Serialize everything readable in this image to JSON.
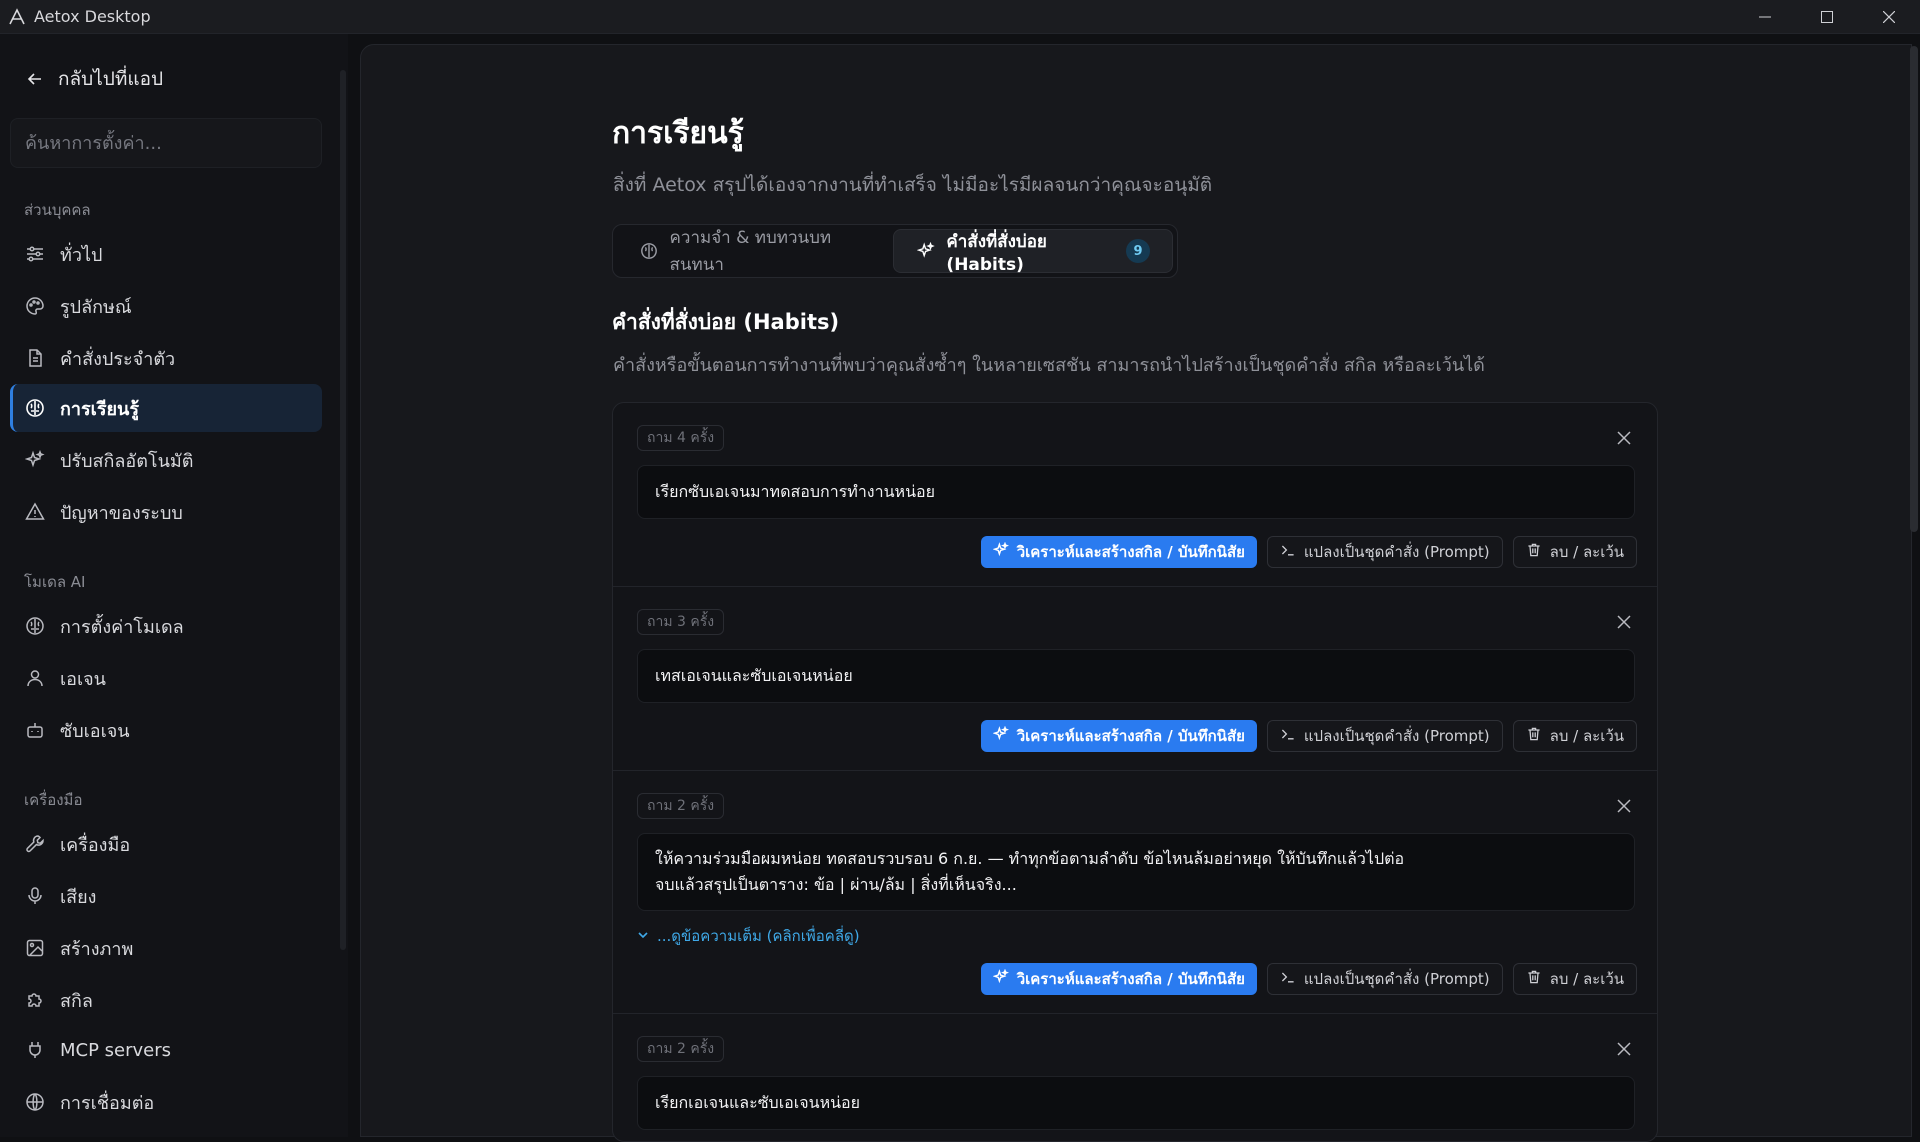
{
  "window": {
    "title": "Aetox Desktop"
  },
  "sidebar": {
    "back_label": "กลับไปที่แอป",
    "search_placeholder": "ค้นหาการตั้งค่า...",
    "sections": [
      {
        "label": "ส่วนบุคคล"
      },
      {
        "label": "โมเดล AI"
      },
      {
        "label": "เครื่องมือ"
      }
    ],
    "items": [
      {
        "label": "ทั่วไป",
        "icon": "sliders-icon"
      },
      {
        "label": "รูปลักษณ์",
        "icon": "palette-icon"
      },
      {
        "label": "คำสั่งประจำตัว",
        "icon": "document-icon"
      },
      {
        "label": "การเรียนรู้",
        "icon": "brain-icon",
        "active": true
      },
      {
        "label": "ปรับสกิลอัตโนมัติ",
        "icon": "sparkles-icon"
      },
      {
        "label": "ปัญหาของระบบ",
        "icon": "warning-icon"
      },
      {
        "label": "การตั้งค่าโมเดล",
        "icon": "brain-icon"
      },
      {
        "label": "เอเจน",
        "icon": "user-icon"
      },
      {
        "label": "ซับเอเจน",
        "icon": "bot-icon"
      },
      {
        "label": "เครื่องมือ",
        "icon": "wrench-icon"
      },
      {
        "label": "เสียง",
        "icon": "microphone-icon"
      },
      {
        "label": "สร้างภาพ",
        "icon": "image-icon"
      },
      {
        "label": "สกิล",
        "icon": "puzzle-icon"
      },
      {
        "label": "MCP servers",
        "icon": "plug-icon"
      },
      {
        "label": "การเชื่อมต่อ",
        "icon": "globe-icon"
      }
    ]
  },
  "page": {
    "title": "การเรียนรู้",
    "subtitle": "สิ่งที่ Aetox สรุปได้เองจากงานที่ทำเสร็จ ไม่มีอะไรมีผลจนกว่าคุณจะอนุมัติ",
    "tabs": [
      {
        "label": "ความจำ & ทบทวนบทสนทนา",
        "icon": "brain-icon"
      },
      {
        "label": "คำสั่งที่สั่งบ่อย (Habits)",
        "icon": "sparkles-icon",
        "count": "9",
        "active": true
      }
    ],
    "section_title": "คำสั่งที่สั่งบ่อย (Habits)",
    "section_desc": "คำสั่งหรือขั้นตอนการทำงานที่พบว่าคุณสั่งซ้ำๆ ในหลายเซสชัน สามารถนำไปสร้างเป็นชุดคำสั่ง สกิล หรือละเว้นได้"
  },
  "actions": {
    "analyze": "วิเคราะห์และสร้างสกิล / บันทึกนิสัย",
    "convert": "แปลงเป็นชุดคำสั่ง (Prompt)",
    "delete": "ลบ / ละเว้น"
  },
  "habits": [
    {
      "badge": "ถาม 4 ครั้ง",
      "lines": [
        "เรียกซับเอเจนมาทดสอบการทำงานหน่อย"
      ]
    },
    {
      "badge": "ถาม 3 ครั้ง",
      "lines": [
        "เทสเอเจนและซับเอเจนหน่อย"
      ]
    },
    {
      "badge": "ถาม 2 ครั้ง",
      "lines": [
        "ให้ความร่วมมือผมหน่อย ทดสอบรวบรอบ 6 ก.ย. — ทำทุกข้อตามลำดับ ข้อไหนล้มอย่าหยุด ให้บันทึกแล้วไปต่อ",
        "จบแล้วสรุปเป็นตาราง: ข้อ | ผ่าน/ล้ม | สิ่งที่เห็นจริง..."
      ],
      "expand_label": "...ดูข้อความเต็ม (คลิกเพื่อคลี่ดู)"
    },
    {
      "badge": "ถาม 2 ครั้ง",
      "lines": [
        "เรียกเอเจนและซับเอเจนหน่อย"
      ]
    }
  ],
  "colors": {
    "accent": "#2a7bf0",
    "link": "#3fa9e8",
    "active_nav_bg": "#172436",
    "background": "#0f1013"
  }
}
